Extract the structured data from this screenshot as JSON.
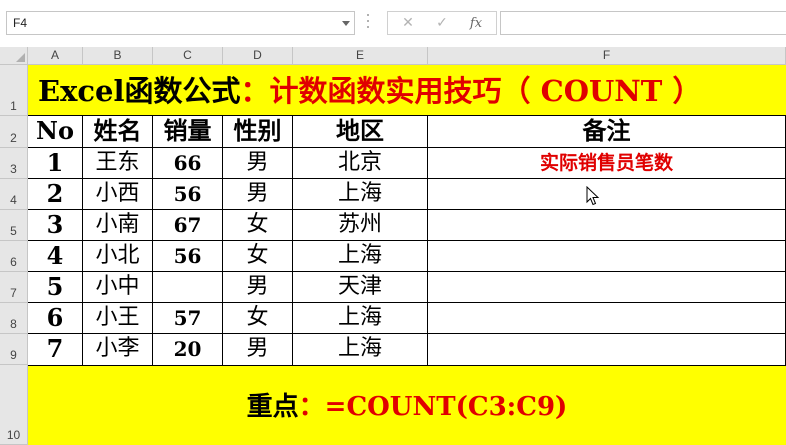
{
  "formula_bar": {
    "name_box": "F4",
    "cancel_icon": "✕",
    "enter_icon": "✓",
    "fx_label": "fx",
    "formula": ""
  },
  "columns": [
    "A",
    "B",
    "C",
    "D",
    "E",
    "F"
  ],
  "rows": [
    "1",
    "2",
    "3",
    "4",
    "5",
    "6",
    "7",
    "8",
    "9",
    "10"
  ],
  "title": {
    "part1": "Excel函数公式",
    "colon": "：",
    "part2": "计数函数实用技巧（ COUNT ）"
  },
  "table": {
    "headers": [
      "No",
      "姓名",
      "销量",
      "性别",
      "地区",
      "备注"
    ],
    "rows": [
      {
        "no": "1",
        "name": "王东",
        "sales": "66",
        "gender": "男",
        "region": "北京",
        "note": "实际销售员笔数"
      },
      {
        "no": "2",
        "name": "小西",
        "sales": "56",
        "gender": "男",
        "region": "上海",
        "note": ""
      },
      {
        "no": "3",
        "name": "小南",
        "sales": "67",
        "gender": "女",
        "region": "苏州",
        "note": ""
      },
      {
        "no": "4",
        "name": "小北",
        "sales": "56",
        "gender": "女",
        "region": "上海",
        "note": ""
      },
      {
        "no": "5",
        "name": "小中",
        "sales": "",
        "gender": "男",
        "region": "天津",
        "note": ""
      },
      {
        "no": "6",
        "name": "小王",
        "sales": "57",
        "gender": "女",
        "region": "上海",
        "note": ""
      },
      {
        "no": "7",
        "name": "小李",
        "sales": "20",
        "gender": "男",
        "region": "上海",
        "note": ""
      }
    ]
  },
  "key_point": {
    "label": "重点",
    "colon": "：",
    "formula": "=COUNT(C3:C9)"
  },
  "colors": {
    "highlight": "#ffff00",
    "accent_red": "#e00000",
    "header_gray": "#e6e6e6"
  }
}
